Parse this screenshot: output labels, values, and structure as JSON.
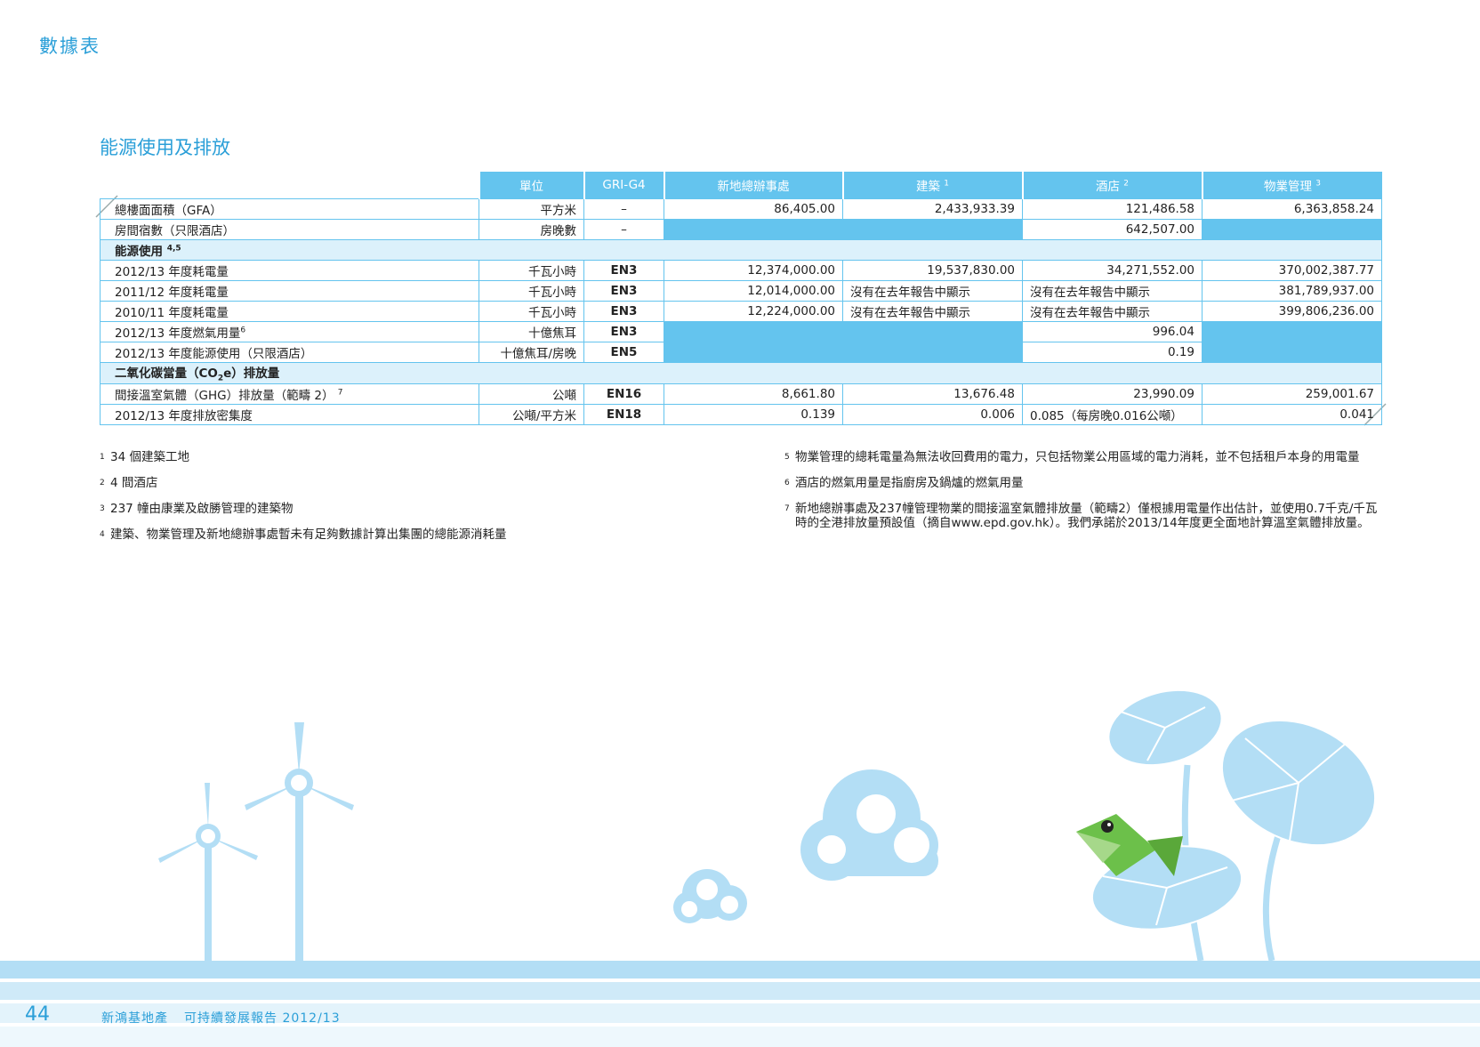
{
  "section_title": "數據表",
  "table_title": "能源使用及排放",
  "table": {
    "headers": [
      {
        "label": "單位",
        "sup": ""
      },
      {
        "label": "GRI-G4",
        "sup": ""
      },
      {
        "label": "新地總辦事處",
        "sup": ""
      },
      {
        "label": "建築",
        "sup": "1"
      },
      {
        "label": "酒店",
        "sup": "2"
      },
      {
        "label": "物業管理",
        "sup": "3"
      }
    ],
    "gfa": {
      "label": "總樓面面積（GFA）",
      "unit": "平方米",
      "gri": "–",
      "hq": "86,405.00",
      "construction": "2,433,933.39",
      "hotel": "121,486.58",
      "pm": "6,363,858.24"
    },
    "room_nights": {
      "label": "房間宿數（只限酒店）",
      "unit": "房晚數",
      "gri": "–",
      "hotel": "642,507.00"
    },
    "energy_group": {
      "label": "能源使用",
      "sup": "4,5"
    },
    "elec_1213": {
      "label": "2012/13 年度耗電量",
      "unit": "千瓦小時",
      "gri": "EN3",
      "hq": "12,374,000.00",
      "construction": "19,537,830.00",
      "hotel": "34,271,552.00",
      "pm": "370,002,387.77"
    },
    "elec_1112": {
      "label": "2011/12 年度耗電量",
      "unit": "千瓦小時",
      "gri": "EN3",
      "hq": "12,014,000.00",
      "construction": "沒有在去年報告中顯示",
      "hotel": "沒有在去年報告中顯示",
      "pm": "381,789,937.00"
    },
    "elec_1011": {
      "label": "2010/11 年度耗電量",
      "unit": "千瓦小時",
      "gri": "EN3",
      "hq": "12,224,000.00",
      "construction": "沒有在去年報告中顯示",
      "hotel": "沒有在去年報告中顯示",
      "pm": "399,806,236.00"
    },
    "gas_1213": {
      "label": "2012/13 年度燃氣用量",
      "sup": "6",
      "unit": "十億焦耳",
      "gri": "EN3",
      "hotel": "996.04"
    },
    "energy_1213": {
      "label": "2012/13 年度能源使用（只限酒店）",
      "unit": "十億焦耳/房晚",
      "gri": "EN5",
      "hotel": "0.19"
    },
    "co2_group": {
      "label_a": "二氧化碳當量（CO",
      "sub": "2",
      "label_b": "e）排放量"
    },
    "ghg": {
      "label": "間接溫室氣體（GHG）排放量（範疇 2）",
      "sup": "7",
      "unit": "公噸",
      "gri": "EN16",
      "hq": "8,661.80",
      "construction": "13,676.48",
      "hotel": "23,990.09",
      "pm": "259,001.67"
    },
    "intensity": {
      "label": "2012/13 年度排放密集度",
      "unit": "公噸/平方米",
      "gri": "EN18",
      "hq": "0.139",
      "construction": "0.006",
      "hotel": "0.085（每房晚0.016公噸）",
      "pm": "0.041"
    }
  },
  "notes": [
    {
      "num": "1",
      "text": "34 個建築工地"
    },
    {
      "num": "2",
      "text": "4 間酒店"
    },
    {
      "num": "3",
      "text": "237 幢由康業及啟勝管理的建築物"
    },
    {
      "num": "4",
      "text": "建築、物業管理及新地總辦事處暫未有足夠數據計算出集團的總能源消耗量"
    },
    {
      "num": "5",
      "text": "物業管理的總耗電量為無法收回費用的電力，只包括物業公用區域的電力消耗，並不包括租戶本身的用電量"
    },
    {
      "num": "6",
      "text": "酒店的燃氣用量是指廚房及鍋爐的燃氣用量"
    },
    {
      "num": "7",
      "text": "新地總辦事處及237幢管理物業的間接溫室氣體排放量（範疇2）僅根據用電量作出估計，並使用0.7千克/千瓦時的全港排放量預設值（摘自www.epd.gov.hk）。我們承諾於2013/14年度更全面地計算溫室氣體排放量。"
    }
  ],
  "footer": {
    "page_number": "44",
    "company": "新鴻基地產",
    "report": "可持續發展報告 2012/13"
  },
  "colors": {
    "accent": "#2b9fd8",
    "table_fill": "#64c4ee",
    "group_fill": "#dcf1fb",
    "illustration": "#b3def5"
  }
}
